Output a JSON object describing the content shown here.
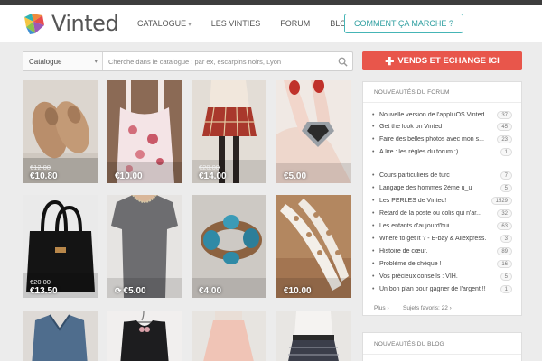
{
  "brand": {
    "name": "Vinted"
  },
  "nav": {
    "catalogue": "CATALOGUE",
    "vinties": "LES VINTIES",
    "forum": "FORUM",
    "blog": "BLOG",
    "cta": "COMMENT ÇA MARCHE ?"
  },
  "search": {
    "category": "Catalogue",
    "placeholder": "Cherche dans le catalogue : par ex, escarpins noirs, Lyon"
  },
  "sell_button": "VENDS ET ECHANGE ICI",
  "items": [
    {
      "old": "€12.00",
      "price": "€10.80"
    },
    {
      "old": "",
      "price": "€10.00"
    },
    {
      "old": "€20.00",
      "price": "€14.00"
    },
    {
      "old": "",
      "price": "€5.00"
    },
    {
      "old": "€20.00",
      "price": "€13.50"
    },
    {
      "old": "",
      "price": "€5.00"
    },
    {
      "old": "",
      "price": "€4.00"
    },
    {
      "old": "",
      "price": "€10.00"
    },
    {
      "old": "",
      "price": ""
    },
    {
      "old": "",
      "price": ""
    },
    {
      "old": "",
      "price": ""
    },
    {
      "old": "",
      "price": ""
    }
  ],
  "forum": {
    "title": "NOUVEAUTÉS DU FORUM",
    "pinned": [
      {
        "title": "Nouvelle version de l'appli iOS Vinted...",
        "count": "37"
      },
      {
        "title": "Get the look on Vinted",
        "count": "45"
      },
      {
        "title": "Faire des belles photos avec mon s...",
        "count": "23"
      },
      {
        "title": "A lire : les règles du forum :)",
        "count": "1"
      }
    ],
    "topics": [
      {
        "title": "Cours particuliers de turc",
        "count": "7"
      },
      {
        "title": "Langage des hommes 2ème u_u",
        "count": "5"
      },
      {
        "title": "Les PERLES de Vinted!",
        "count": "1529"
      },
      {
        "title": "Retard de la poste ou colis qui n'ar...",
        "count": "32"
      },
      {
        "title": "Les enfants d'aujourd'hui",
        "count": "63"
      },
      {
        "title": "Where to get it ? - E-bay & Aliexpress.",
        "count": "3"
      },
      {
        "title": "Histoire de cœur.",
        "count": "89"
      },
      {
        "title": "Problème de chèque !",
        "count": "16"
      },
      {
        "title": "Vos précieux conseils : VIH.",
        "count": "5"
      },
      {
        "title": "Un bon plan pour gagner de l'argent !!",
        "count": "1"
      }
    ],
    "more": "Plus",
    "favorites": "Sujets favoris: 22"
  },
  "blog": {
    "title": "NOUVEAUTÉS DU BLOG"
  }
}
